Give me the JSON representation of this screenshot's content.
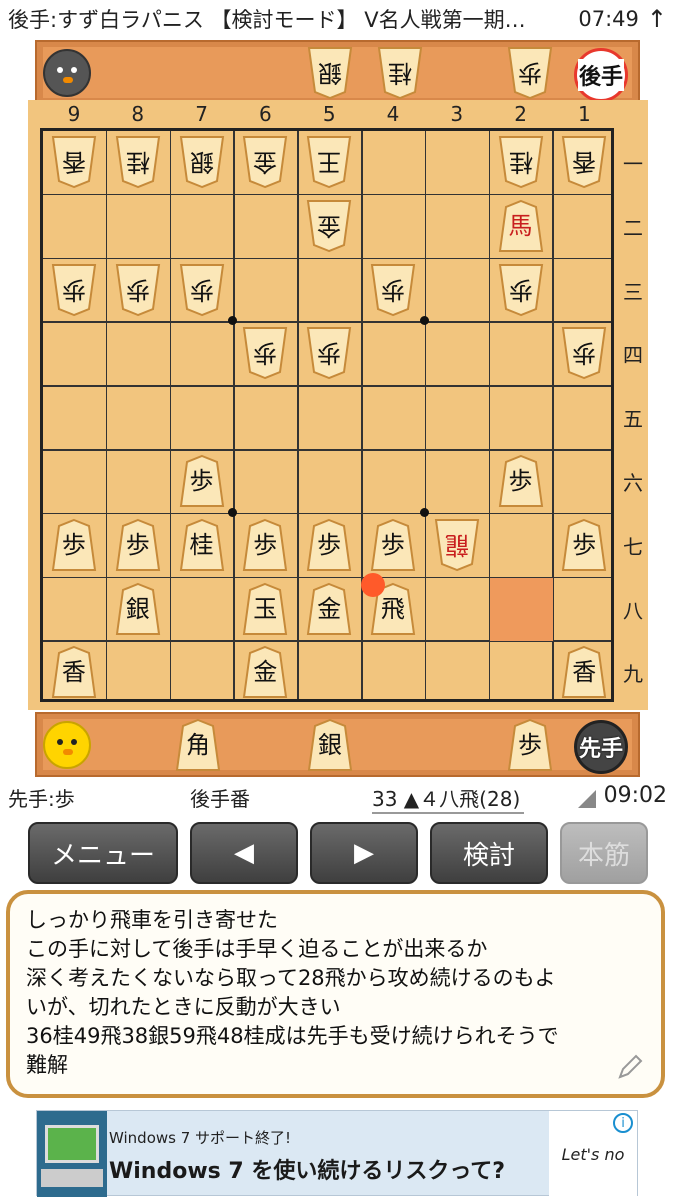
{
  "status_bar": {
    "title": "後手:すず白ラパニス 【検討モード】 V名人戦第一期…",
    "time": "07:49",
    "up_icon": "↑"
  },
  "gote_hand": {
    "player_avatar": "penguin-avatar",
    "pieces": [
      "銀",
      "桂",
      "歩"
    ],
    "badge": "後手"
  },
  "sente_hand": {
    "player_avatar": "chick-avatar",
    "pieces": [
      "角",
      "銀",
      "歩"
    ],
    "badge": "先手"
  },
  "board": {
    "file_labels": [
      "9",
      "8",
      "7",
      "6",
      "5",
      "4",
      "3",
      "2",
      "1"
    ],
    "rank_labels": [
      "一",
      "二",
      "三",
      "四",
      "五",
      "六",
      "七",
      "八",
      "九"
    ],
    "highlight_square": {
      "file": 2,
      "rank": 8
    },
    "last_move_marker": {
      "file": 4,
      "rank": 8
    },
    "pieces": [
      {
        "file": 9,
        "rank": 1,
        "kind": "香",
        "owner": "gote"
      },
      {
        "file": 8,
        "rank": 1,
        "kind": "桂",
        "owner": "gote"
      },
      {
        "file": 7,
        "rank": 1,
        "kind": "銀",
        "owner": "gote"
      },
      {
        "file": 6,
        "rank": 1,
        "kind": "金",
        "owner": "gote"
      },
      {
        "file": 5,
        "rank": 1,
        "kind": "王",
        "owner": "gote"
      },
      {
        "file": 2,
        "rank": 1,
        "kind": "桂",
        "owner": "gote"
      },
      {
        "file": 1,
        "rank": 1,
        "kind": "香",
        "owner": "gote"
      },
      {
        "file": 5,
        "rank": 2,
        "kind": "金",
        "owner": "gote"
      },
      {
        "file": 2,
        "rank": 2,
        "kind": "馬",
        "owner": "sente",
        "promoted": true
      },
      {
        "file": 9,
        "rank": 3,
        "kind": "歩",
        "owner": "gote"
      },
      {
        "file": 8,
        "rank": 3,
        "kind": "歩",
        "owner": "gote"
      },
      {
        "file": 7,
        "rank": 3,
        "kind": "歩",
        "owner": "gote"
      },
      {
        "file": 4,
        "rank": 3,
        "kind": "歩",
        "owner": "gote"
      },
      {
        "file": 2,
        "rank": 3,
        "kind": "歩",
        "owner": "gote"
      },
      {
        "file": 6,
        "rank": 4,
        "kind": "歩",
        "owner": "gote"
      },
      {
        "file": 5,
        "rank": 4,
        "kind": "歩",
        "owner": "gote"
      },
      {
        "file": 1,
        "rank": 4,
        "kind": "歩",
        "owner": "gote"
      },
      {
        "file": 7,
        "rank": 6,
        "kind": "歩",
        "owner": "sente"
      },
      {
        "file": 2,
        "rank": 6,
        "kind": "歩",
        "owner": "sente"
      },
      {
        "file": 9,
        "rank": 7,
        "kind": "歩",
        "owner": "sente"
      },
      {
        "file": 8,
        "rank": 7,
        "kind": "歩",
        "owner": "sente"
      },
      {
        "file": 7,
        "rank": 7,
        "kind": "桂",
        "owner": "sente"
      },
      {
        "file": 6,
        "rank": 7,
        "kind": "歩",
        "owner": "sente"
      },
      {
        "file": 5,
        "rank": 7,
        "kind": "歩",
        "owner": "sente"
      },
      {
        "file": 4,
        "rank": 7,
        "kind": "歩",
        "owner": "sente"
      },
      {
        "file": 3,
        "rank": 7,
        "kind": "龍",
        "owner": "gote",
        "promoted": true
      },
      {
        "file": 1,
        "rank": 7,
        "kind": "歩",
        "owner": "sente"
      },
      {
        "file": 8,
        "rank": 8,
        "kind": "銀",
        "owner": "sente"
      },
      {
        "file": 6,
        "rank": 8,
        "kind": "玉",
        "owner": "sente"
      },
      {
        "file": 5,
        "rank": 8,
        "kind": "金",
        "owner": "sente"
      },
      {
        "file": 4,
        "rank": 8,
        "kind": "飛",
        "owner": "sente"
      },
      {
        "file": 9,
        "rank": 9,
        "kind": "香",
        "owner": "sente"
      },
      {
        "file": 6,
        "rank": 9,
        "kind": "金",
        "owner": "sente"
      },
      {
        "file": 1,
        "rank": 9,
        "kind": "香",
        "owner": "sente"
      }
    ]
  },
  "info": {
    "sente_hand_text": "先手:歩",
    "turn": "後手番",
    "move": "33 ▲４八飛(28)",
    "elapsed": "09:02"
  },
  "buttons": {
    "menu": "メニュー",
    "prev": "◀",
    "next": "▶",
    "analyze": "検討",
    "mainline": "本筋"
  },
  "comment": {
    "lines": [
      "しっかり飛車を引き寄せた",
      "この手に対して後手は手早く迫ることが出来るか",
      "深く考えたくないなら取って28飛から攻め続けるのもよ",
      "いが、切れたときに反動が大きい",
      "36桂49飛38銀59飛48桂成は先手も受け続けられそうで",
      "難解"
    ]
  },
  "ad": {
    "small": "Windows 7 サポート終了!",
    "big": "Windows 7 を使い続けるリスクって?",
    "brand": "Let's no",
    "info_icon": "i"
  }
}
